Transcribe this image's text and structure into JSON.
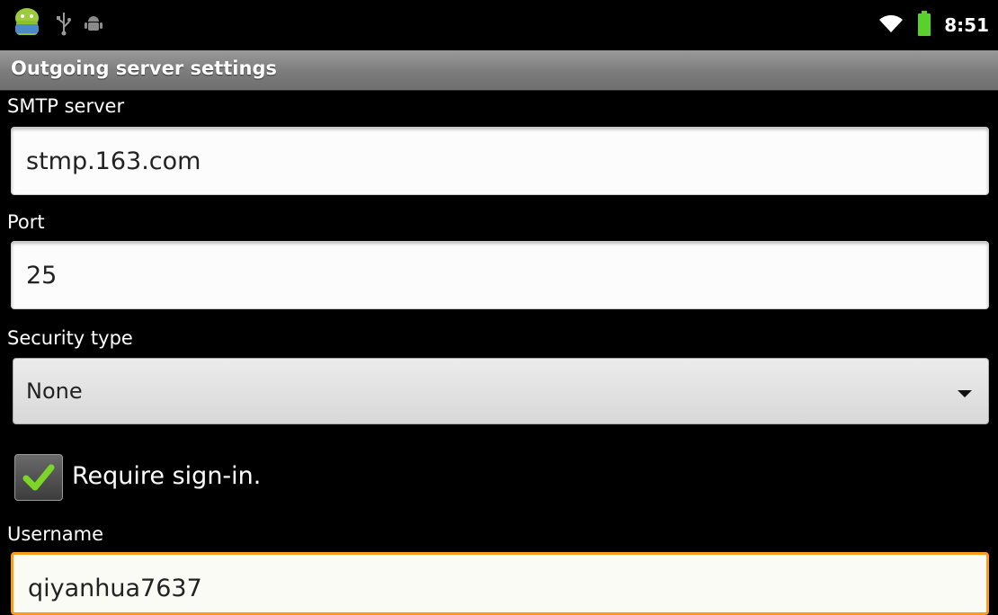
{
  "status_bar": {
    "time": "8:51",
    "icons": [
      "android-robot-icon",
      "usb-icon",
      "debug-icon",
      "wifi-icon",
      "battery-icon"
    ]
  },
  "title_bar": {
    "title": "Outgoing server settings"
  },
  "smtp": {
    "label": "SMTP server",
    "value": "stmp.163.com"
  },
  "port": {
    "label": "Port",
    "value": "25"
  },
  "security": {
    "label": "Security type",
    "value": "None"
  },
  "require_signin": {
    "label": "Require sign-in.",
    "checked": true
  },
  "username": {
    "label": "Username",
    "value": "qiyanhua7637"
  },
  "colors": {
    "accent_focus": "#ff9a1a",
    "check_green": "#7cd62a",
    "battery_green": "#5ad12a"
  }
}
